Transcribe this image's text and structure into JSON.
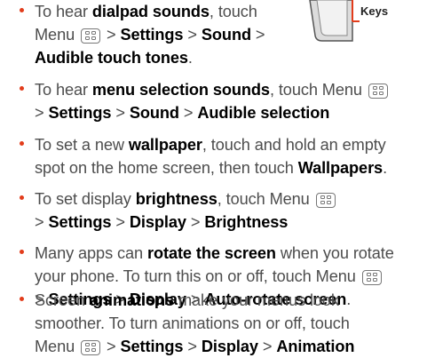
{
  "callout": {
    "label": "Keys"
  },
  "items": [
    {
      "runs_1": [
        {
          "t": "To hear ",
          "b": false
        },
        {
          "t": "dialpad sounds",
          "b": true
        },
        {
          "t": ", touch",
          "b": false
        }
      ],
      "runs_2": [
        {
          "t": "Menu ",
          "b": false
        },
        {
          "key": "menu-key"
        },
        {
          "t": " > ",
          "b": false
        },
        {
          "t": "Settings",
          "b": true
        },
        {
          "t": " > ",
          "b": false
        },
        {
          "t": "Sound",
          "b": true
        },
        {
          "t": " >",
          "b": false
        }
      ],
      "runs_3": [
        {
          "t": "Audible touch tones",
          "b": true
        },
        {
          "t": ".",
          "b": false
        }
      ]
    },
    {
      "runs_1": [
        {
          "t": "To hear ",
          "b": false
        },
        {
          "t": "menu selection sounds",
          "b": true
        },
        {
          "t": ", touch Menu ",
          "b": false
        },
        {
          "key": "menu-key"
        }
      ],
      "runs_2": [
        {
          "t": "> ",
          "b": false
        },
        {
          "t": "Settings",
          "b": true
        },
        {
          "t": " > ",
          "b": false
        },
        {
          "t": "Sound",
          "b": true
        },
        {
          "t": " > ",
          "b": false
        },
        {
          "t": "Audible selection",
          "b": true
        }
      ]
    },
    {
      "runs_1": [
        {
          "t": "To set a new ",
          "b": false
        },
        {
          "t": "wallpaper",
          "b": true
        },
        {
          "t": ", touch and hold an empty",
          "b": false
        }
      ],
      "runs_2": [
        {
          "t": "spot on the home screen, then touch ",
          "b": false
        },
        {
          "t": "Wallpapers",
          "b": true
        },
        {
          "t": ".",
          "b": false
        }
      ]
    },
    {
      "runs_1": [
        {
          "t": "To set display ",
          "b": false
        },
        {
          "t": "brightness",
          "b": true
        },
        {
          "t": ", touch Menu ",
          "b": false
        },
        {
          "key": "menu-key"
        }
      ],
      "runs_2": [
        {
          "t": "> ",
          "b": false
        },
        {
          "t": "Settings",
          "b": true
        },
        {
          "t": " > ",
          "b": false
        },
        {
          "t": "Display",
          "b": true
        },
        {
          "t": " > ",
          "b": false
        },
        {
          "t": "Brightness",
          "b": true
        }
      ]
    },
    {
      "runs_1": [
        {
          "t": "Many apps can ",
          "b": false
        },
        {
          "t": "rotate the screen",
          "b": true
        },
        {
          "t": " when you rotate",
          "b": false
        }
      ],
      "runs_2": [
        {
          "t": "your phone. To turn this on or off, touch Menu ",
          "b": false
        },
        {
          "key": "menu-key"
        }
      ],
      "runs_3": [
        {
          "t": "> ",
          "b": false
        },
        {
          "t": "Settings",
          "b": true
        },
        {
          "t": " > ",
          "b": false
        },
        {
          "t": "Display",
          "b": true
        },
        {
          "t": " > ",
          "b": false
        },
        {
          "t": "Auto-rotate screen",
          "b": true
        },
        {
          "t": ".",
          "b": false
        }
      ]
    },
    {
      "runs_1": [
        {
          "t": "Screen ",
          "b": false
        },
        {
          "t": "animations",
          "b": true
        },
        {
          "t": " make your menus look",
          "b": false
        }
      ],
      "runs_2": [
        {
          "t": "smoother. To turn animations on or off, touch",
          "b": false
        }
      ],
      "runs_3": [
        {
          "t": "Menu ",
          "b": false
        },
        {
          "key": "menu-key"
        },
        {
          "t": " > ",
          "b": false
        },
        {
          "t": "Settings",
          "b": true
        },
        {
          "t": " > ",
          "b": false
        },
        {
          "t": "Display",
          "b": true
        },
        {
          "t": " > ",
          "b": false
        },
        {
          "t": "Animation",
          "b": true
        }
      ]
    }
  ]
}
